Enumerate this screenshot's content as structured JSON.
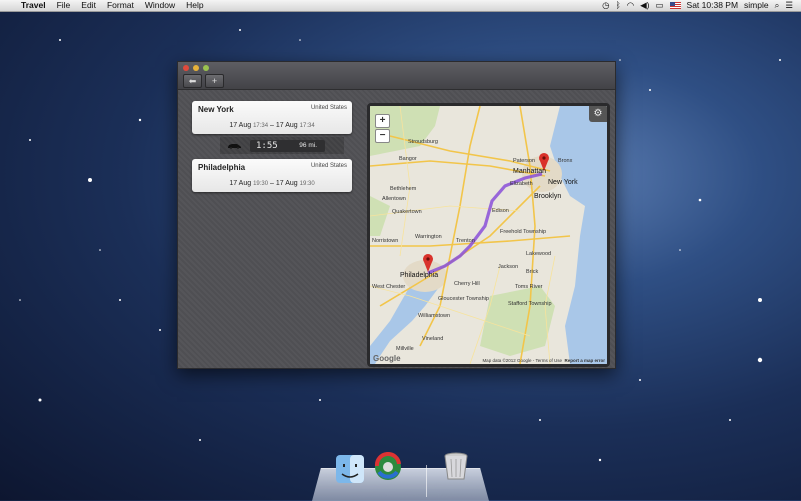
{
  "menubar": {
    "apple": "",
    "app_name": "Travel",
    "menus": [
      "File",
      "Edit",
      "Format",
      "Window",
      "Help"
    ],
    "clock": "Sat 10:38 PM",
    "user": "simple"
  },
  "window": {
    "stops": [
      {
        "city": "New York",
        "country": "United States",
        "date_from": "17 Aug",
        "time_from": "17:34",
        "date_to": "17 Aug",
        "time_to": "17:34"
      },
      {
        "city": "Philadelphia",
        "country": "United States",
        "date_from": "17 Aug",
        "time_from": "19:30",
        "date_to": "17 Aug",
        "time_to": "19:30"
      }
    ],
    "route": {
      "duration": "1:55",
      "distance": "96 mi."
    }
  },
  "map": {
    "labels": {
      "stroudsburg": "Stroudsburg",
      "bangor": "Bangor",
      "paterson": "Paterson",
      "bronx": "Bronx",
      "manhattan": "Manhattan",
      "new_york": "New York",
      "elizabeth": "Elizabeth",
      "bethlehem": "Bethlehem",
      "allentown": "Allentown",
      "brooklyn": "Brooklyn",
      "edison": "Edison",
      "quakertown": "Quakertown",
      "warrington": "Warrington",
      "trenton": "Trenton",
      "freehold_township": "Freehold Township",
      "lakewood": "Lakewood",
      "jackson": "Jackson",
      "brick": "Brick",
      "norristown": "Norristown",
      "philadelphia": "Philadelphia",
      "cherry_hill": "Cherry Hill",
      "toms_river": "Toms River",
      "west_chester": "West Chester",
      "gloucester_township": "Gloucester Township",
      "stafford_township": "Stafford Township",
      "williamstown": "Williamstown",
      "vineland": "Vineland",
      "millville": "Millville",
      "google": "Google",
      "attribution": "Map data ©2012 Google - Terms of Use",
      "report": "Report a map error"
    },
    "zoom_in": "+",
    "zoom_out": "−"
  },
  "colors": {
    "route": "#8a4fd8",
    "pin": "#d9322b"
  },
  "dock": {
    "items": [
      "finder-icon",
      "time-machine-icon",
      "trash-icon"
    ]
  }
}
